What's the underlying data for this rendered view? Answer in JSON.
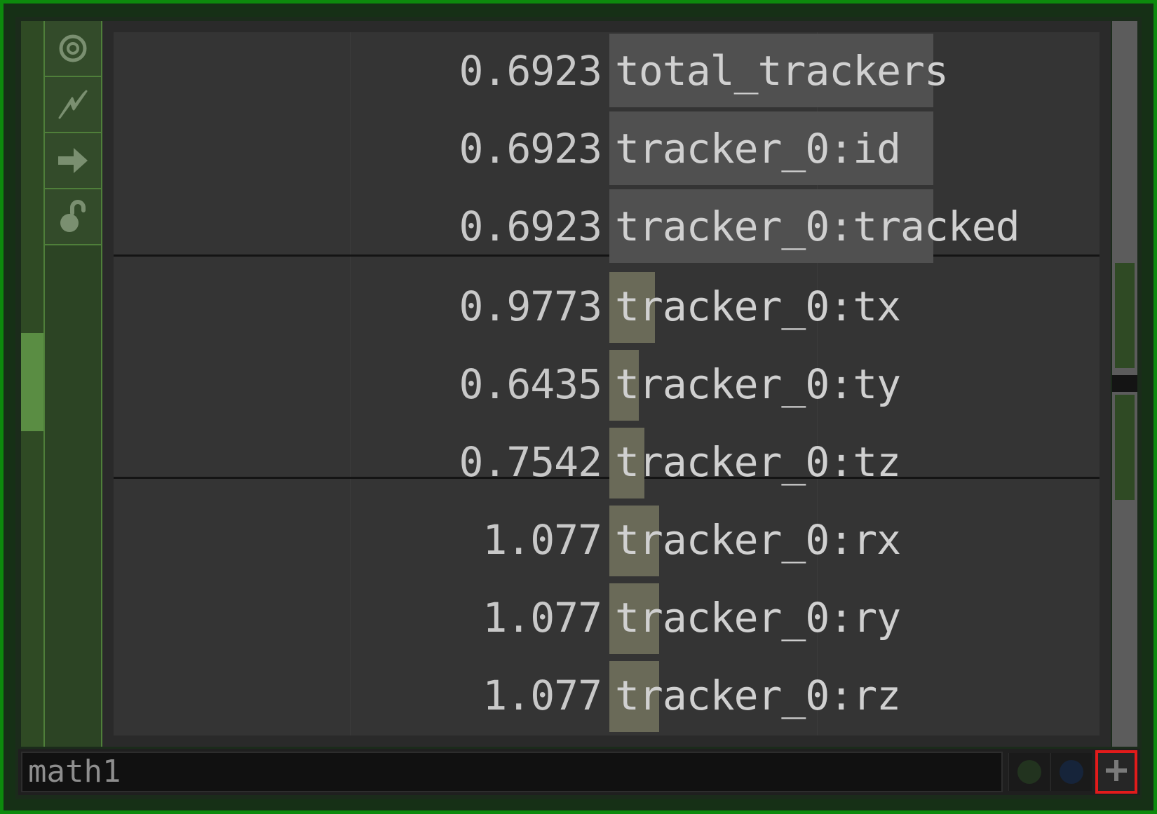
{
  "node": {
    "name": "math1"
  },
  "flags": [
    {
      "id": "viewer-toggle",
      "icon": "target-icon"
    },
    {
      "id": "export-flag",
      "icon": "lightning-icon"
    },
    {
      "id": "cook-flag",
      "icon": "arrow-right-icon"
    },
    {
      "id": "lock-flag",
      "icon": "unlock-icon"
    }
  ],
  "channels": [
    {
      "value": "0.6923",
      "name": "total_trackers",
      "bar": 0.6923,
      "group": 0
    },
    {
      "value": "0.6923",
      "name": "tracker_0:id",
      "bar": 0.6923,
      "group": 0
    },
    {
      "value": "0.6923",
      "name": "tracker_0:tracked",
      "bar": 0.6923,
      "group": 0
    },
    {
      "value": "0.9773",
      "name": "tracker_0:tx",
      "bar": 0.9773,
      "group": 1
    },
    {
      "value": "0.6435",
      "name": "tracker_0:ty",
      "bar": 0.6435,
      "group": 1
    },
    {
      "value": "0.7542",
      "name": "tracker_0:tz",
      "bar": 0.7542,
      "group": 1
    },
    {
      "value": "1.077",
      "name": "tracker_0:rx",
      "bar": 1.077,
      "group": 2
    },
    {
      "value": "1.077",
      "name": "tracker_0:ry",
      "bar": 1.077,
      "group": 2
    },
    {
      "value": "1.077",
      "name": "tracker_0:rz",
      "bar": 1.077,
      "group": 2
    }
  ],
  "colors": {
    "frame_border": "#0d8a0d",
    "bar_group_0": "#505050",
    "bar_group_other": "#6a6a58",
    "highlight_outline": "#e21b1b",
    "status_dot_green": "#22331f",
    "status_dot_blue": "#16243a"
  },
  "bottom_bar": {
    "buttons": [
      "status-dot-green",
      "status-dot-blue",
      "add-button"
    ]
  }
}
